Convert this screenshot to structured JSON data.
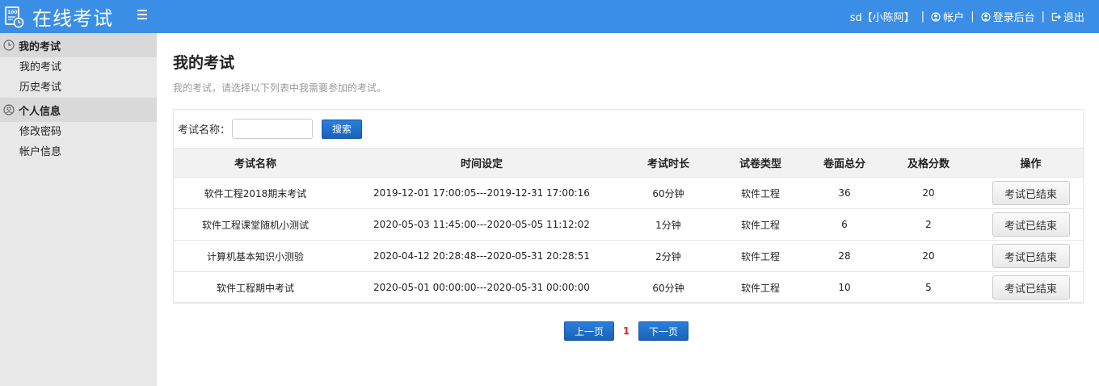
{
  "header": {
    "title": "在线考试",
    "logo_icon": "exam-logo-icon",
    "menu_icon": "hamburger-menu-icon",
    "user": "sd【小陈阿】",
    "account_label": "帐户",
    "backend_label": "登录后台",
    "logout_label": "退出",
    "colors": {
      "bar": "#3a8ee6"
    }
  },
  "sidebar": {
    "groups": [
      {
        "label": "我的考试",
        "icon": "clock-icon",
        "items": [
          "我的考试",
          "历史考试"
        ]
      },
      {
        "label": "个人信息",
        "icon": "user-circle-icon",
        "items": [
          "修改密码",
          "帐户信息"
        ]
      }
    ]
  },
  "main": {
    "title": "我的考试",
    "subtitle": "我的考试，请选择以下列表中我需要参加的考试。",
    "search": {
      "label": "考试名称：",
      "value": "",
      "button": "搜索"
    },
    "table": {
      "columns": [
        "考试名称",
        "时间设定",
        "考试时长",
        "试卷类型",
        "卷面总分",
        "及格分数",
        "操作"
      ],
      "rows": [
        {
          "name": "软件工程2018期末考试",
          "time": "2019-12-01 17:00:05---2019-12-31 17:00:16",
          "duration": "60分钟",
          "type": "软件工程",
          "total": "36",
          "pass": "20",
          "action": "考试已结束"
        },
        {
          "name": "软件工程课堂随机小测试",
          "time": "2020-05-03 11:45:00---2020-05-05 11:12:02",
          "duration": "1分钟",
          "type": "软件工程",
          "total": "6",
          "pass": "2",
          "action": "考试已结束"
        },
        {
          "name": "计算机基本知识小测验",
          "time": "2020-04-12 20:28:48---2020-05-31 20:28:51",
          "duration": "2分钟",
          "type": "软件工程",
          "total": "28",
          "pass": "20",
          "action": "考试已结束"
        },
        {
          "name": "软件工程期中考试",
          "time": "2020-05-01 00:00:00---2020-05-31 00:00:00",
          "duration": "60分钟",
          "type": "软件工程",
          "total": "10",
          "pass": "5",
          "action": "考试已结束"
        }
      ]
    },
    "pager": {
      "prev": "上一页",
      "current": "1",
      "next": "下一页"
    }
  }
}
